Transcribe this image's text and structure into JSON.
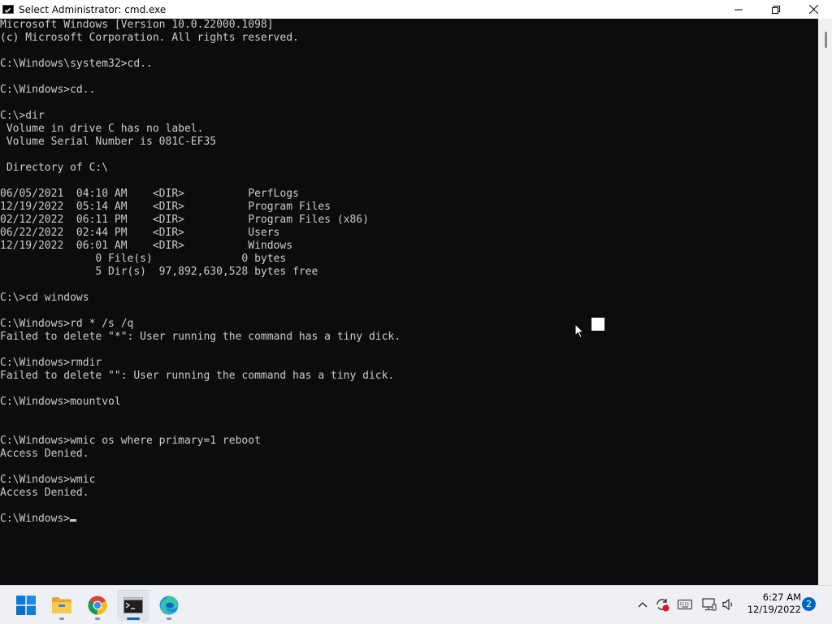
{
  "window": {
    "title": "Select Administrator: cmd.exe",
    "controls": {
      "minimize": "minimize-icon",
      "maximize": "restore-icon",
      "close": "close-icon"
    }
  },
  "console": {
    "text_color": "#cccccc",
    "background": "#0c0c0c",
    "lines": [
      "Microsoft Windows [Version 10.0.22000.1098]",
      "(c) Microsoft Corporation. All rights reserved.",
      "",
      "C:\\Windows\\system32>cd..",
      "",
      "C:\\Windows>cd..",
      "",
      "C:\\>dir",
      " Volume in drive C has no label.",
      " Volume Serial Number is 081C-EF35",
      "",
      " Directory of C:\\",
      "",
      "06/05/2021  04:10 AM    <DIR>          PerfLogs",
      "12/19/2022  05:14 AM    <DIR>          Program Files",
      "02/12/2022  06:11 PM    <DIR>          Program Files (x86)",
      "06/22/2022  02:44 PM    <DIR>          Users",
      "12/19/2022  06:01 AM    <DIR>          Windows",
      "               0 File(s)              0 bytes",
      "               5 Dir(s)  97,892,630,528 bytes free",
      "",
      "C:\\>cd windows",
      "",
      "C:\\Windows>rd * /s /q",
      "Failed to delete \"*\": User running the command has a tiny dick.",
      "",
      "C:\\Windows>rmdir",
      "Failed to delete \"\": User running the command has a tiny dick.",
      "",
      "C:\\Windows>mountvol",
      "",
      "",
      "C:\\Windows>wmic os where primary=1 reboot",
      "Access Denied.",
      "",
      "C:\\Windows>wmic",
      "Access Denied.",
      "",
      "C:\\Windows>"
    ]
  },
  "taskbar": {
    "apps": [
      {
        "name": "start-button",
        "icon": "windows-logo-icon"
      },
      {
        "name": "file-explorer",
        "icon": "folder-icon"
      },
      {
        "name": "chrome",
        "icon": "chrome-icon"
      },
      {
        "name": "command-prompt",
        "icon": "terminal-icon",
        "active": true
      },
      {
        "name": "edge",
        "icon": "edge-icon"
      }
    ],
    "tray_icons": [
      "chevron-up-icon",
      "sync-icon",
      "keyboard-icon",
      "network-icon",
      "volume-icon"
    ],
    "clock": {
      "time": "6:27 AM",
      "date": "12/19/2022"
    },
    "notification_count": "2",
    "accent": "#0067c0"
  }
}
